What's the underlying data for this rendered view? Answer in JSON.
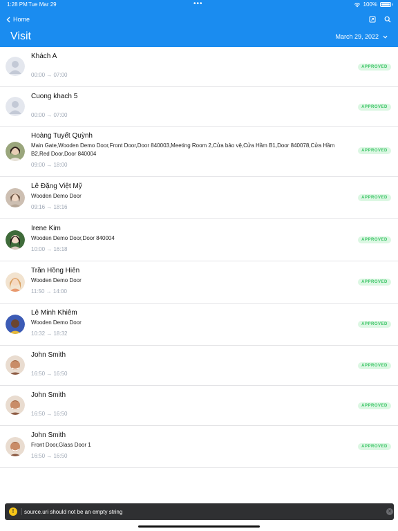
{
  "status_bar": {
    "time": "1:28 PM",
    "date": "Tue Mar 29",
    "battery": "100%"
  },
  "nav": {
    "back_label": "Home",
    "title": "Visit",
    "date": "March 29, 2022"
  },
  "colors": {
    "header": "#1a8cf0",
    "badge_bg": "#dcf7e3",
    "badge_text": "#3cc466",
    "time_text": "#9fa8b5"
  },
  "visits": [
    {
      "name": "Khách A",
      "doors": "",
      "time": "00:00 → 07:00",
      "status": "APPROVED",
      "avatar": "placeholder"
    },
    {
      "name": "Cuong khach 5",
      "doors": "",
      "time": "00:00 → 07:00",
      "status": "APPROVED",
      "avatar": "placeholder"
    },
    {
      "name": "Hoàng Tuyết Quỳnh",
      "doors": "Main Gate,Wooden Demo Door,Front Door,Door 840003,Meeting Room 2,Cửa bảo vệ,Cửa Hầm B1,Door 840078,Cửa Hầm B2,Red Door,Door 840004",
      "time": "09:00 → 18:00",
      "status": "APPROVED",
      "avatar": "photo"
    },
    {
      "name": "Lê Đặng Việt Mỹ",
      "doors": "Wooden Demo Door",
      "time": "09:16 → 18:16",
      "status": "APPROVED",
      "avatar": "photo"
    },
    {
      "name": "Irene Kim",
      "doors": "Wooden Demo Door,Door 840004",
      "time": "10:00 → 16:18",
      "status": "APPROVED",
      "avatar": "photo"
    },
    {
      "name": "Trần Hồng Hiên",
      "doors": "Wooden Demo Door",
      "time": "11:50 → 14:00",
      "status": "APPROVED",
      "avatar": "photo"
    },
    {
      "name": "Lê Minh Khiêm",
      "doors": "Wooden Demo Door",
      "time": "10:32 → 18:32",
      "status": "APPROVED",
      "avatar": "photo"
    },
    {
      "name": "John Smith",
      "doors": "",
      "time": "16:50 → 16:50",
      "status": "APPROVED",
      "avatar": "photo"
    },
    {
      "name": "John Smith",
      "doors": "",
      "time": "16:50 → 16:50",
      "status": "APPROVED",
      "avatar": "photo"
    },
    {
      "name": "John Smith",
      "doors": "Front Door,Glass Door 1",
      "time": "16:50 → 16:50",
      "status": "APPROVED",
      "avatar": "photo"
    }
  ],
  "toast": {
    "icon": "warning-icon",
    "message": "source.uri should not be an empty string"
  }
}
